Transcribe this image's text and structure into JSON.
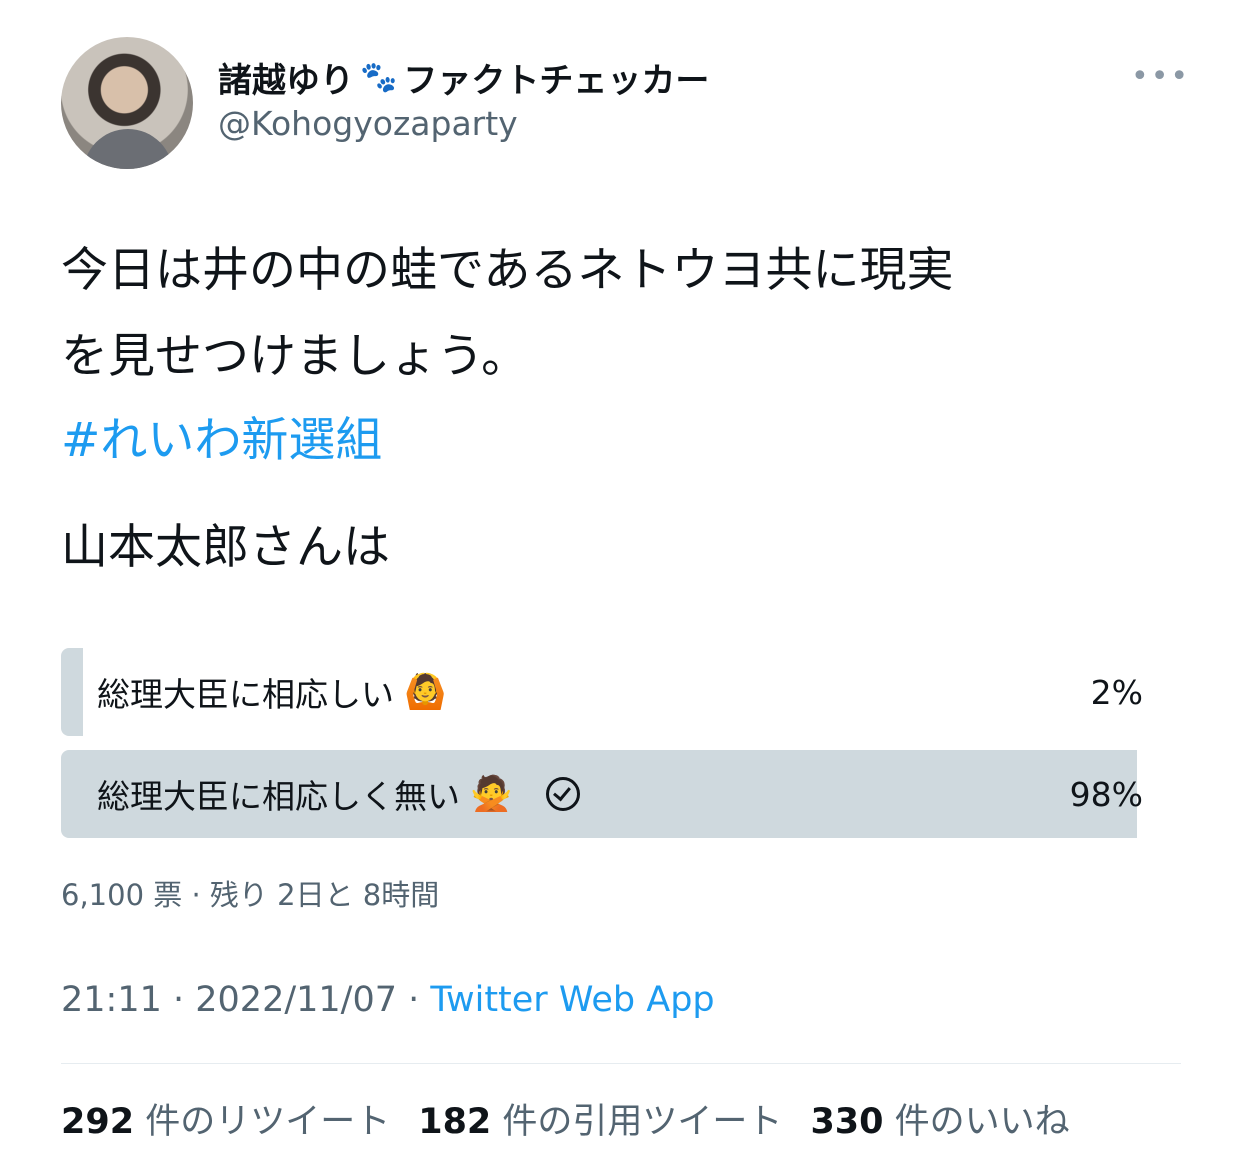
{
  "user": {
    "display_name": "諸越ゆり",
    "paw_icon": "paw-prints-icon",
    "name_suffix": "ファクトチェッカー",
    "handle": "@Kohogyozaparty"
  },
  "tweet": {
    "text_line1": "今日は井の中の蛙であるネトウヨ共に現実",
    "text_line2": "を見せつけましょう。",
    "hashtag": "#れいわ新選組",
    "question": "山本太郎さんは"
  },
  "poll": {
    "options": [
      {
        "label": "総理大臣に相応しい",
        "emoji": "🙆",
        "percent_text": "2%",
        "percent": 2
      },
      {
        "label": "総理大臣に相応しく無い",
        "emoji": "🙅",
        "percent_text": "98%",
        "percent": 98,
        "voted": true
      }
    ],
    "meta": "6,100 票 · 残り 2日と 8時間"
  },
  "timestamp": {
    "time": "21:11",
    "sep1": " · ",
    "date": "2022/11/07",
    "sep2": " · ",
    "source": "Twitter Web App"
  },
  "stats": {
    "retweets_count": "292",
    "retweets_label": "件のリツイート",
    "quotes_count": "182",
    "quotes_label": "件の引用ツイート",
    "likes_count": "330",
    "likes_label": "件のいいね"
  },
  "colors": {
    "link": "#1d9bf0",
    "secondary_text": "#536471",
    "poll_bar": "#cfd9de"
  }
}
